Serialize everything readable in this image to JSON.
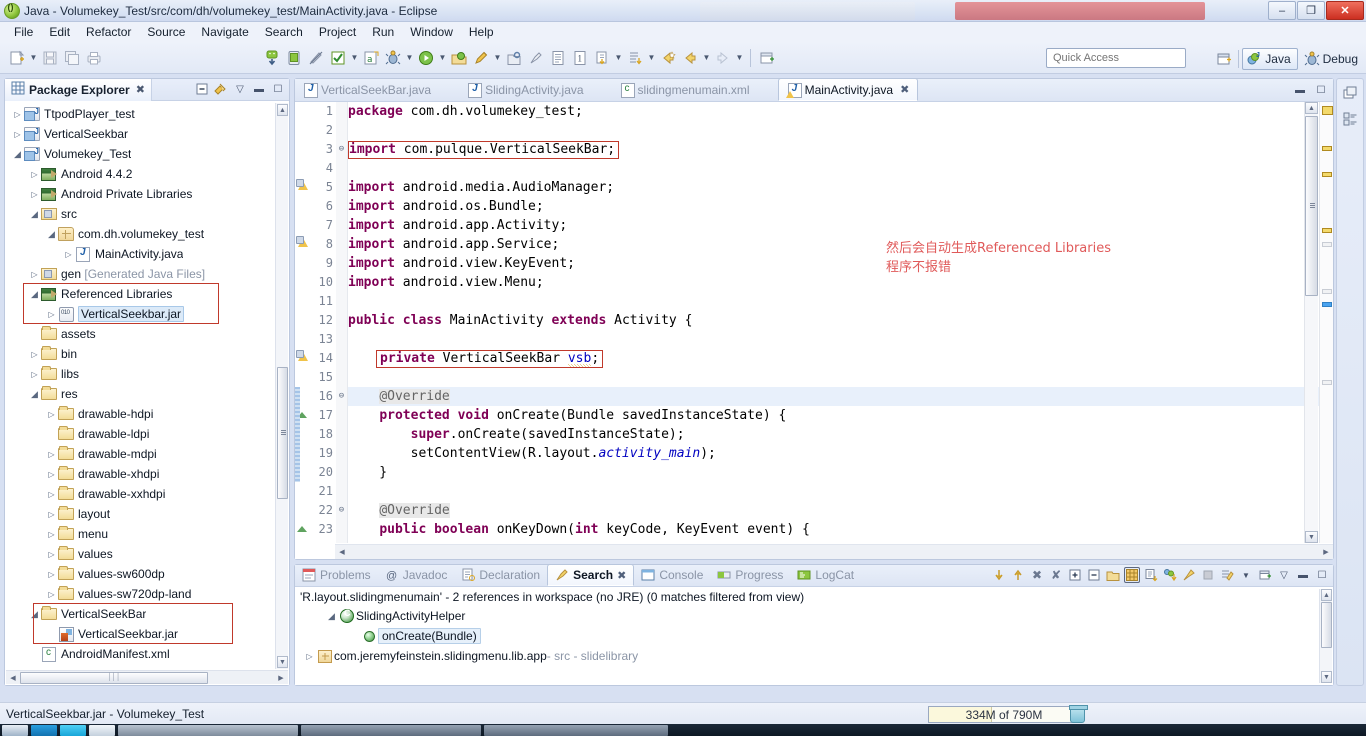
{
  "window": {
    "title": "Java - Volumekey_Test/src/com/dh/volumekey_test/MainActivity.java - Eclipse",
    "app_icon": "eclipse-icon",
    "minimize_label": "–",
    "maximize_label": "❐",
    "close_label": "✕",
    "background_windows": [
      {
        "name": "ghost-window-explorer",
        "label": ""
      },
      {
        "name": "ghost-window-red",
        "label": ""
      }
    ]
  },
  "menubar": {
    "items": [
      "File",
      "Edit",
      "Refactor",
      "Source",
      "Navigate",
      "Search",
      "Project",
      "Run",
      "Window",
      "Help"
    ]
  },
  "toolbar": {
    "left_groups": [
      {
        "icons": [
          "new-wizard-icon",
          "dropdown-arrow",
          "save-icon",
          "save-all-icon",
          "print-icon"
        ]
      },
      {
        "icons": [
          "android-sdk-manager-icon",
          "android-avd-manager-icon",
          "lint-warnings-icon",
          "check-icon",
          "dropdown-arrow",
          "new-android-project-icon",
          "debug-icon",
          "dropdown-arrow",
          "run-icon",
          "dropdown-arrow"
        ]
      },
      {
        "icons": [
          "run-external-tools-icon",
          "dropdown-arrow",
          "new-java-package-icon",
          "dropdown-arrow",
          "search-icon",
          "pencil-icon",
          "open-type-icon",
          "toggle-mark-occurrences-icon",
          "last-edit-location-icon",
          "dropdown-arrow",
          "next-annotation-icon",
          "dropdown-arrow",
          "back-icon",
          "dropdown-arrow",
          "forward-icon",
          "dropdown-arrow",
          "new-window-icon"
        ]
      }
    ],
    "quick_access_placeholder": "Quick Access",
    "open_perspective_label": "open-perspective-icon",
    "perspectives": [
      {
        "label": "Java",
        "icon": "java-perspective-icon",
        "active": true
      },
      {
        "label": "Debug",
        "icon": "debug-perspective-icon",
        "active": false
      }
    ]
  },
  "package_explorer": {
    "tab_label": "Package Explorer",
    "tab_icon": "package-explorer-icon",
    "close_label": "✖",
    "tools": [
      "collapse-all-icon",
      "link-with-editor-icon",
      "view-menu-icon",
      "minimize-icon",
      "maximize-icon"
    ],
    "tree": [
      {
        "indent": 0,
        "twisty": "closed",
        "icon": "java-project-icon",
        "label": "TtpodPlayer_test",
        "dim": false
      },
      {
        "indent": 0,
        "twisty": "closed",
        "icon": "java-project-icon",
        "label": "VerticalSeekbar",
        "dim": false
      },
      {
        "indent": 0,
        "twisty": "open",
        "icon": "java-project-icon",
        "label": "Volumekey_Test",
        "dim": false
      },
      {
        "indent": 1,
        "twisty": "closed",
        "icon": "library-icon",
        "label": "Android 4.4.2",
        "dim": false
      },
      {
        "indent": 1,
        "twisty": "closed",
        "icon": "library-icon",
        "label": "Android Private Libraries",
        "dim": false
      },
      {
        "indent": 1,
        "twisty": "open",
        "icon": "source-folder-icon",
        "label": "src",
        "dim": false
      },
      {
        "indent": 2,
        "twisty": "open",
        "icon": "package-icon",
        "label": "com.dh.volumekey_test",
        "dim": false
      },
      {
        "indent": 3,
        "twisty": "closed",
        "icon": "java-file-icon",
        "label": "MainActivity.java",
        "dim": false
      },
      {
        "indent": 1,
        "twisty": "closed",
        "icon": "source-folder-icon",
        "label": "gen [Generated Java Files]",
        "dim": true
      },
      {
        "indent": 1,
        "twisty": "open",
        "icon": "library-icon",
        "label": "Referenced Libraries",
        "dim": false,
        "highlight": "red-box-top"
      },
      {
        "indent": 2,
        "twisty": "closed",
        "icon": "jar-icon",
        "label": "VerticalSeekbar.jar",
        "dim": false,
        "selected": true
      },
      {
        "indent": 1,
        "twisty": "none",
        "icon": "folder-icon",
        "label": "assets",
        "dim": false
      },
      {
        "indent": 1,
        "twisty": "closed",
        "icon": "folder-icon",
        "label": "bin",
        "dim": false
      },
      {
        "indent": 1,
        "twisty": "closed",
        "icon": "folder-icon",
        "label": "libs",
        "dim": false
      },
      {
        "indent": 1,
        "twisty": "open",
        "icon": "folder-icon",
        "label": "res",
        "dim": false
      },
      {
        "indent": 2,
        "twisty": "closed",
        "icon": "folder-icon",
        "label": "drawable-hdpi",
        "dim": false
      },
      {
        "indent": 2,
        "twisty": "none",
        "icon": "folder-icon",
        "label": "drawable-ldpi",
        "dim": false
      },
      {
        "indent": 2,
        "twisty": "closed",
        "icon": "folder-icon",
        "label": "drawable-mdpi",
        "dim": false
      },
      {
        "indent": 2,
        "twisty": "closed",
        "icon": "folder-icon",
        "label": "drawable-xhdpi",
        "dim": false
      },
      {
        "indent": 2,
        "twisty": "closed",
        "icon": "folder-icon",
        "label": "drawable-xxhdpi",
        "dim": false
      },
      {
        "indent": 2,
        "twisty": "closed",
        "icon": "folder-icon",
        "label": "layout",
        "dim": false
      },
      {
        "indent": 2,
        "twisty": "closed",
        "icon": "folder-icon",
        "label": "menu",
        "dim": false
      },
      {
        "indent": 2,
        "twisty": "closed",
        "icon": "folder-icon",
        "label": "values",
        "dim": false
      },
      {
        "indent": 2,
        "twisty": "closed",
        "icon": "folder-icon",
        "label": "values-sw600dp",
        "dim": false
      },
      {
        "indent": 2,
        "twisty": "closed",
        "icon": "folder-icon",
        "label": "values-sw720dp-land",
        "dim": false
      },
      {
        "indent": 1,
        "twisty": "open",
        "icon": "folder-icon",
        "label": "VerticalSeekBar",
        "dim": false,
        "highlight": "red-box-bottom"
      },
      {
        "indent": 2,
        "twisty": "none",
        "icon": "jar-lib-icon",
        "label": "VerticalSeekbar.jar",
        "dim": false
      },
      {
        "indent": 1,
        "twisty": "none",
        "icon": "xml-file-icon",
        "label": "AndroidManifest.xml",
        "dim": false
      }
    ]
  },
  "editor": {
    "tabs": [
      {
        "label": "VerticalSeekBar.java",
        "icon": "java-file-icon",
        "active": false
      },
      {
        "label": "SlidingActivity.java",
        "icon": "java-file-icon",
        "active": false
      },
      {
        "label": "slidingmenumain.xml",
        "icon": "xml-file-icon",
        "active": false
      },
      {
        "label": "MainActivity.java",
        "icon": "java-file-warning-icon",
        "active": true,
        "close_label": "✖"
      }
    ],
    "tools": [
      "minimize-icon",
      "maximize-icon"
    ],
    "lines": [
      {
        "n": 1,
        "fold": "",
        "marker": "",
        "text": "package com.dh.volumekey_test;"
      },
      {
        "n": 2,
        "fold": "",
        "marker": "",
        "text": ""
      },
      {
        "n": 3,
        "fold": "⊖",
        "marker": "",
        "text": "import com.pulque.VerticalSeekBar;",
        "boxed": true
      },
      {
        "n": 4,
        "fold": "",
        "marker": "",
        "text": ""
      },
      {
        "n": 5,
        "fold": "",
        "marker": "warn",
        "text": "import android.media.AudioManager;"
      },
      {
        "n": 6,
        "fold": "",
        "marker": "",
        "text": "import android.os.Bundle;"
      },
      {
        "n": 7,
        "fold": "",
        "marker": "",
        "text": "import android.app.Activity;"
      },
      {
        "n": 8,
        "fold": "",
        "marker": "warn",
        "text": "import android.app.Service;"
      },
      {
        "n": 9,
        "fold": "",
        "marker": "",
        "text": "import android.view.KeyEvent;"
      },
      {
        "n": 10,
        "fold": "",
        "marker": "",
        "text": "import android.view.Menu;"
      },
      {
        "n": 11,
        "fold": "",
        "marker": "",
        "text": ""
      },
      {
        "n": 12,
        "fold": "",
        "marker": "",
        "text": "public class MainActivity extends Activity {"
      },
      {
        "n": 13,
        "fold": "",
        "marker": "",
        "text": ""
      },
      {
        "n": 14,
        "fold": "",
        "marker": "warn",
        "text": "    private VerticalSeekBar vsb;",
        "boxed": true
      },
      {
        "n": 15,
        "fold": "",
        "marker": "",
        "text": ""
      },
      {
        "n": 16,
        "fold": "⊖",
        "marker": "",
        "text": "    @Override",
        "highlight": true
      },
      {
        "n": 17,
        "fold": "",
        "marker": "override",
        "text": "    protected void onCreate(Bundle savedInstanceState) {"
      },
      {
        "n": 18,
        "fold": "",
        "marker": "",
        "text": "        super.onCreate(savedInstanceState);"
      },
      {
        "n": 19,
        "fold": "",
        "marker": "",
        "text": "        setContentView(R.layout.activity_main);"
      },
      {
        "n": 20,
        "fold": "",
        "marker": "",
        "text": "    }"
      },
      {
        "n": 21,
        "fold": "",
        "marker": "",
        "text": ""
      },
      {
        "n": 22,
        "fold": "⊖",
        "marker": "",
        "text": "    @Override"
      },
      {
        "n": 23,
        "fold": "",
        "marker": "override",
        "text": "    public boolean onKeyDown(int keyCode, KeyEvent event) {"
      }
    ],
    "annotation": {
      "line1": "然后会自动生成Referenced Libraries",
      "line2": "程序不报错",
      "color": "#e05a5a"
    }
  },
  "bottom_panel": {
    "tabs": [
      {
        "label": "Problems",
        "icon": "problems-icon",
        "active": false
      },
      {
        "label": "Javadoc",
        "icon": "javadoc-icon",
        "active": false
      },
      {
        "label": "Declaration",
        "icon": "declaration-icon",
        "active": false
      },
      {
        "label": "Search",
        "icon": "search-icon",
        "active": true,
        "close_label": "✖"
      },
      {
        "label": "Console",
        "icon": "console-icon",
        "active": false
      },
      {
        "label": "Progress",
        "icon": "progress-icon",
        "active": false
      },
      {
        "label": "LogCat",
        "icon": "logcat-icon",
        "active": false
      }
    ],
    "tools": [
      "next-match-icon",
      "previous-match-icon",
      "remove-selected-matches-icon",
      "remove-all-matches-icon",
      "expand-all-icon",
      "collapse-all-icon",
      "open-previous-search-icon",
      "show-as-tree-icon",
      "show-as-list-icon",
      "sort-icon",
      "pin-search-icon",
      "stop-icon",
      "search-history-icon",
      "dropdown-arrow",
      "new-search-icon",
      "view-menu-icon",
      "minimize-icon",
      "maximize-icon"
    ],
    "summary": "'R.layout.slidingmenumain' - 2 references in workspace (no JRE) (0 matches filtered from view)",
    "results": [
      {
        "indent": 1,
        "twisty": "open",
        "icon": "class-icon",
        "label": "SlidingActivityHelper",
        "sub": ""
      },
      {
        "indent": 2,
        "twisty": "none",
        "icon": "method-icon",
        "label": "onCreate(Bundle)",
        "sub": "",
        "selected": true
      },
      {
        "indent": 0,
        "twisty": "closed",
        "icon": "package-icon",
        "label": "com.jeremyfeinstein.slidingmenu.lib.app",
        "sub": " - src - slidelibrary"
      }
    ]
  },
  "right_stack": {
    "icons": [
      "restore-icon",
      "outline-icon"
    ]
  },
  "statusbar": {
    "text": "VerticalSeekbar.jar - Volumekey_Test",
    "heap": "334M of 790M",
    "heap_used_percent": 42,
    "trash_icon": "trash-icon"
  }
}
